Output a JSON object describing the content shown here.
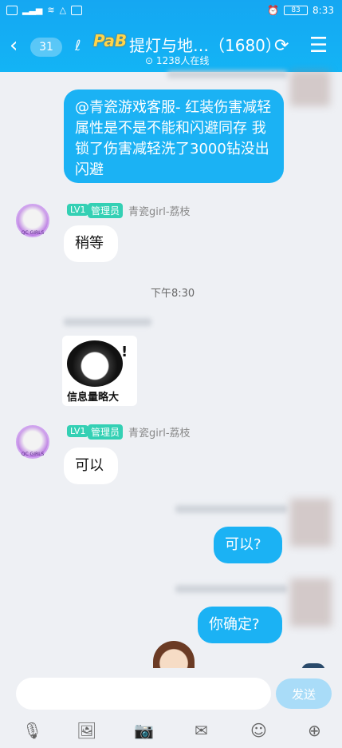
{
  "status_bar": {
    "time": "8:33",
    "battery": "83"
  },
  "header": {
    "back_count": "31",
    "logo_text": "PaB",
    "title": "提灯与地…（1680）",
    "online": "⊙ 1238人在线"
  },
  "messages": {
    "msg1": "@青瓷游戏客服-     红装伤害减轻属性是不是不能和闪避同存 我锁了伤害减轻洗了3000钻没出闪避",
    "admin_level": "LV1",
    "admin_role": "管理员",
    "admin_name": "青瓷girl-荔枝",
    "admin_reply1": "稍等",
    "time_divider": "下午8:30",
    "sticker_caption": "信息量略大",
    "admin_reply2": "可以",
    "out1": "可以?",
    "out2": "你确定?"
  },
  "input": {
    "send_label": "发送"
  },
  "toolbar": {
    "icons": [
      "microphone-icon",
      "image-icon",
      "camera-icon",
      "red-packet-icon",
      "emoji-icon",
      "plus-icon"
    ]
  }
}
